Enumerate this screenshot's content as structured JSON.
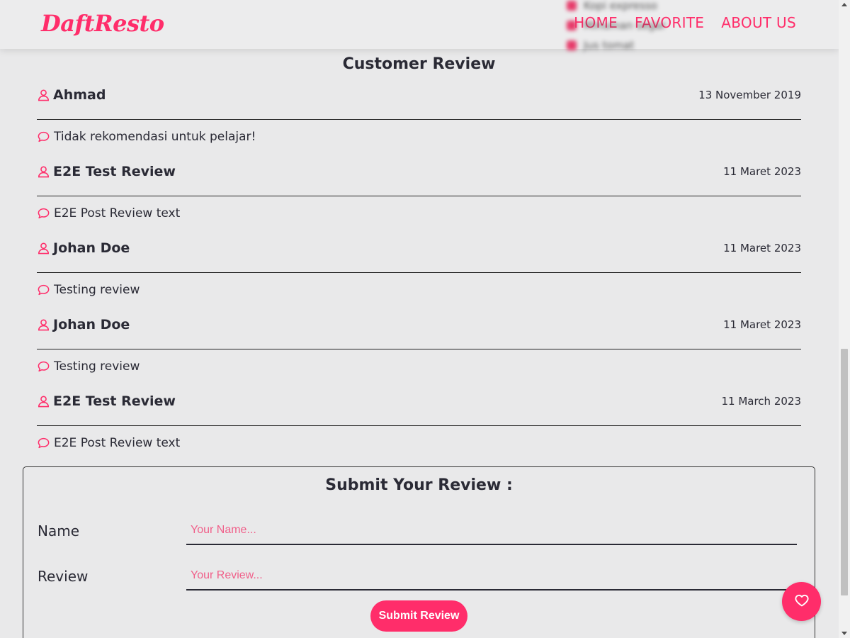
{
  "brand": "DaftResto",
  "nav": {
    "items": [
      "HOME",
      "FAVORITE",
      "ABOUT US"
    ]
  },
  "background_menu": [
    "Kopi expresso",
    "Minuman segar",
    "Jus tomat"
  ],
  "reviews_section": {
    "title": "Customer Review",
    "reviews": [
      {
        "name": "Ahmad",
        "date": "13 November 2019",
        "text": "Tidak rekomendasi untuk pelajar!"
      },
      {
        "name": "E2E Test Review",
        "date": "11 Maret 2023",
        "text": "E2E Post Review text"
      },
      {
        "name": "Johan Doe",
        "date": "11 Maret 2023",
        "text": "Testing review"
      },
      {
        "name": "Johan Doe",
        "date": "11 Maret 2023",
        "text": "Testing review"
      },
      {
        "name": "E2E Test Review",
        "date": "11 March 2023",
        "text": "E2E Post Review text"
      }
    ]
  },
  "form": {
    "title": "Submit Your Review :",
    "name_label": "Name",
    "name_placeholder": "Your Name...",
    "review_label": "Review",
    "review_placeholder": "Your Review...",
    "submit_label": "Submit Review"
  },
  "fab": {
    "icon": "heart-icon"
  },
  "colors": {
    "accent": "#ff2d6a",
    "background": "#e9e9ea"
  }
}
